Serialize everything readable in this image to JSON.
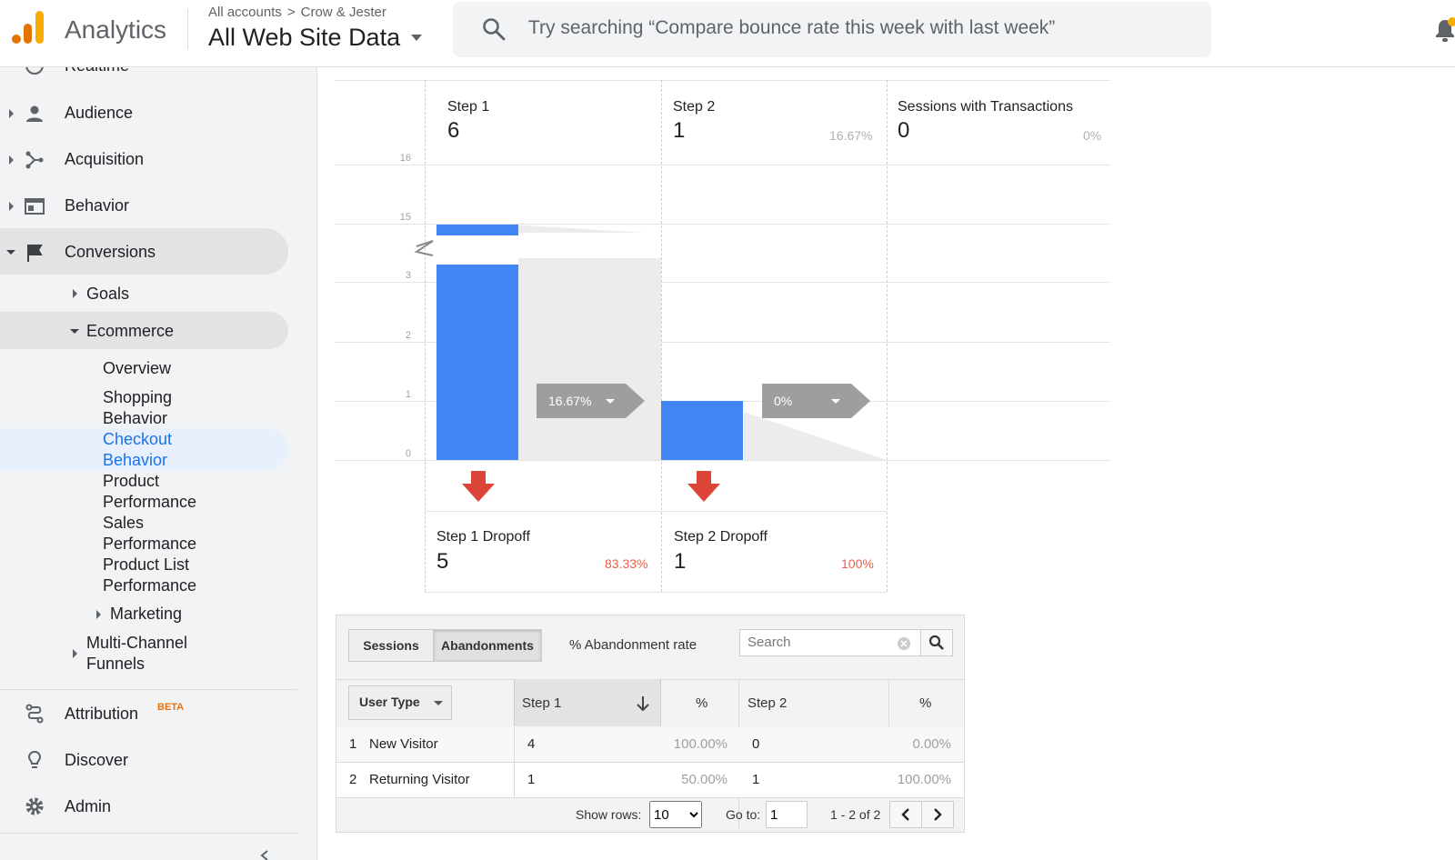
{
  "header": {
    "app_name": "Analytics",
    "breadcrumb": [
      "All accounts",
      "Crow & Jester"
    ],
    "breadcrumb_sep": ">",
    "view": "All Web Site Data",
    "search_placeholder": "Try searching “Compare bounce rate this week with last week”"
  },
  "sidebar": {
    "partial_item": "Realtime",
    "items": [
      {
        "label": "Audience",
        "icon": "person-icon"
      },
      {
        "label": "Acquisition",
        "icon": "acquisition-icon"
      },
      {
        "label": "Behavior",
        "icon": "behavior-icon"
      },
      {
        "label": "Conversions",
        "icon": "flag-icon"
      }
    ],
    "conversions": {
      "goals": "Goals",
      "ecommerce": "Ecommerce",
      "ecommerce_items": [
        {
          "lines": [
            "Overview"
          ]
        },
        {
          "lines": [
            "Shopping",
            "Behavior"
          ]
        },
        {
          "lines": [
            "Checkout",
            "Behavior"
          ],
          "selected": true
        },
        {
          "lines": [
            "Product",
            "Performance"
          ]
        },
        {
          "lines": [
            "Sales",
            "Performance"
          ]
        },
        {
          "lines": [
            "Product List",
            "Performance"
          ]
        }
      ],
      "marketing": "Marketing",
      "mcf": [
        "Multi-Channel",
        "Funnels"
      ]
    },
    "attribution": "Attribution",
    "beta": "BETA",
    "discover": "Discover",
    "admin": "Admin"
  },
  "funnel": {
    "y_ticks": [
      "16",
      "15",
      "3",
      "2",
      "1",
      "0"
    ],
    "steps": [
      {
        "name": "Step 1",
        "value": "6",
        "pct": ""
      },
      {
        "name": "Step 2",
        "value": "1",
        "pct": "16.67%"
      },
      {
        "name": "Sessions with Transactions",
        "value": "0",
        "pct": "0%"
      }
    ],
    "conversion_tags": [
      "16.67%",
      "0%"
    ],
    "dropoffs": [
      {
        "name": "Step 1 Dropoff",
        "value": "5",
        "pct": "83.33%"
      },
      {
        "name": "Step 2 Dropoff",
        "value": "1",
        "pct": "100%"
      }
    ]
  },
  "chart_data": {
    "type": "bar",
    "categories": [
      "Step 1",
      "Step 2",
      "Sessions with Transactions"
    ],
    "values": [
      6,
      1,
      0
    ],
    "dropoffs": [
      5,
      1
    ]
  },
  "table": {
    "tab_sessions": "Sessions",
    "tab_abandonments": "Abandonments",
    "rate_label": "% Abandonment rate",
    "search_placeholder": "Search",
    "dimension": "User Type",
    "headers": [
      "Step 1",
      "%",
      "Step 2",
      "%"
    ],
    "rows": [
      {
        "n": "1",
        "type": "New Visitor",
        "s1": "4",
        "p1": "100.00%",
        "s2": "0",
        "p2": "0.00%"
      },
      {
        "n": "2",
        "type": "Returning Visitor",
        "s1": "1",
        "p1": "50.00%",
        "s2": "1",
        "p2": "100.00%"
      }
    ],
    "show_rows_label": "Show rows:",
    "show_rows_value": "10",
    "goto_label": "Go to:",
    "goto_value": "1",
    "range": "1 - 2 of 2"
  },
  "colors": {
    "bar": "#4285f4",
    "selected_nav": "#1a73e8",
    "dropoff_arrow": "#db4437"
  }
}
